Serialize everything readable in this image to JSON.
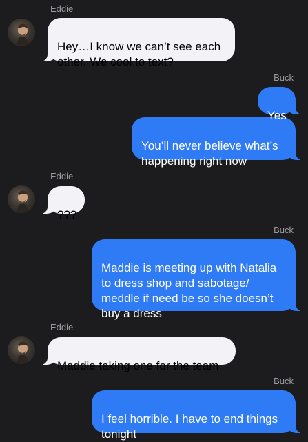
{
  "colors": {
    "background": "#1c1c1e",
    "incoming_bubble": "#f2f2f7",
    "outgoing_bubble": "#2f7bf6",
    "sender_label": "#9a9a9f"
  },
  "messages": [
    {
      "sender": "Eddie",
      "direction": "incoming",
      "text": "Hey…I know we can’t see each\nother. We cool to text?"
    },
    {
      "sender": "Buck",
      "direction": "outgoing",
      "text": "Yes"
    },
    {
      "sender": "Buck",
      "direction": "outgoing",
      "text": "You’ll never believe what’s\nhappening right now"
    },
    {
      "sender": "Eddie",
      "direction": "incoming",
      "text": "???"
    },
    {
      "sender": "Buck",
      "direction": "outgoing",
      "text": "Maddie is meeting up with Natalia\nto dress shop and sabotage/\nmeddle if need be so she doesn’t\nbuy a dress"
    },
    {
      "sender": "Eddie",
      "direction": "incoming",
      "text": "Maddie taking one for the team"
    },
    {
      "sender": "Buck",
      "direction": "outgoing",
      "text": "I feel horrible. I have to end things\ntonight"
    }
  ],
  "avatar": {
    "icon": "contact-photo-eddie"
  }
}
